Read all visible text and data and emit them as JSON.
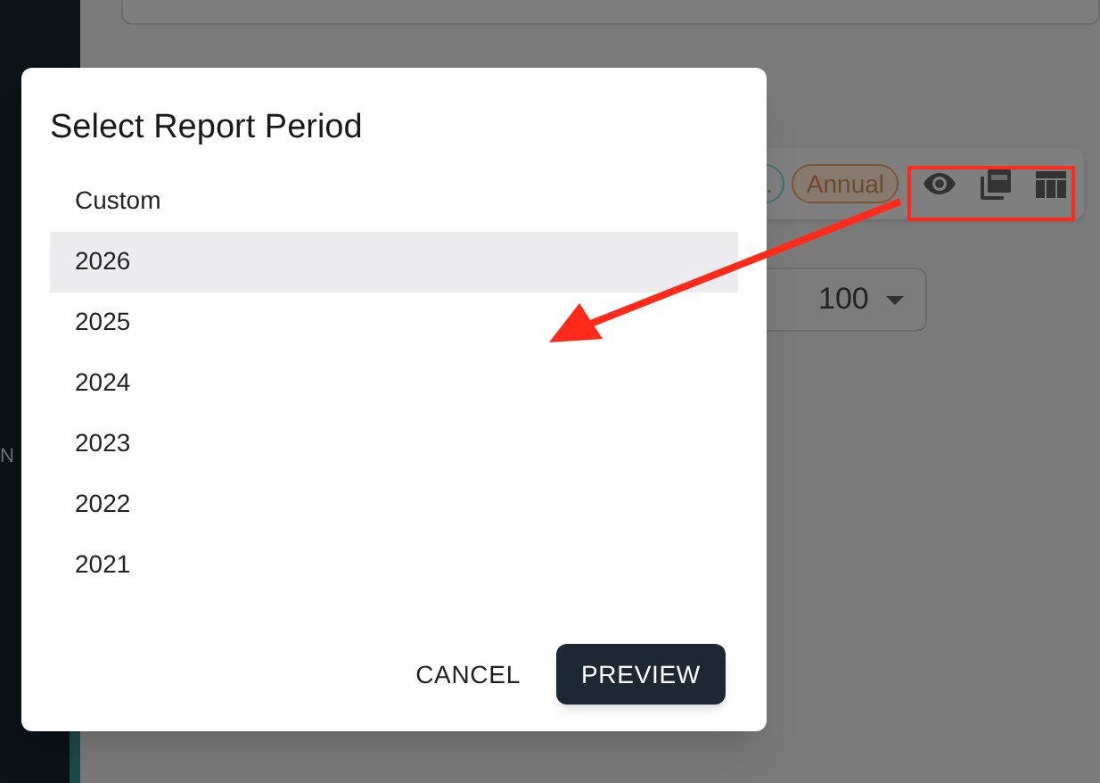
{
  "sidebar": {
    "label": "N"
  },
  "toolbar": {
    "chips": [
      {
        "label": ".",
        "kind": "teal"
      },
      {
        "label": "Annual",
        "kind": "brown"
      }
    ]
  },
  "rows_select": {
    "value": "100"
  },
  "dialog": {
    "title": "Select Report Period",
    "options": [
      {
        "label": "Custom",
        "selected": false
      },
      {
        "label": "2026",
        "selected": true
      },
      {
        "label": "2025",
        "selected": false
      },
      {
        "label": "2024",
        "selected": false
      },
      {
        "label": "2023",
        "selected": false
      },
      {
        "label": "2022",
        "selected": false
      },
      {
        "label": "2021",
        "selected": false
      }
    ],
    "buttons": [
      {
        "label": "CANCEL",
        "kind": "text"
      },
      {
        "label": "PREVIEW",
        "kind": "primary"
      }
    ]
  }
}
